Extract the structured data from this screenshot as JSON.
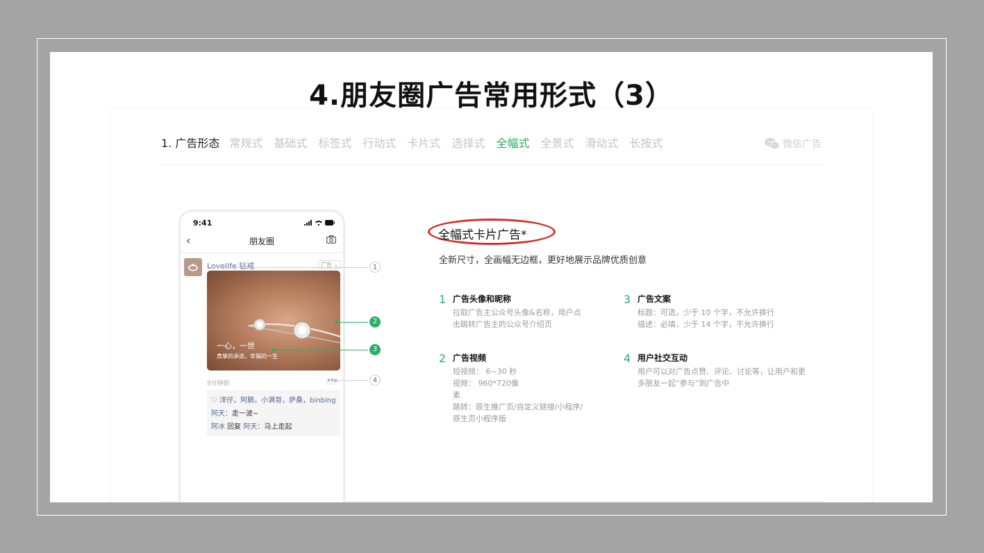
{
  "slide": {
    "title": "4.朋友圈广告常用形式（3）"
  },
  "nav": {
    "lead": "1. 广告形态",
    "tabs": [
      "常规式",
      "基础式",
      "标签式",
      "行动式",
      "卡片式",
      "选择式",
      "全幅式",
      "全景式",
      "滑动式",
      "长按式"
    ],
    "active_index": 6,
    "brand": "微信广告"
  },
  "phone": {
    "time": "9:41",
    "header_title": "朋友圈",
    "account": "Lovelife 钻戒",
    "ad_tag": "广告",
    "media_copy_1": "一心，一世",
    "media_copy_2": "真挚的承诺，幸福的一生",
    "post_time": "9分钟前",
    "likes": "洋仔，阿鹏，小满哥，萨桑，binbing",
    "comment1_user": "阿天：",
    "comment1_text": "走一波~",
    "comment2_user": "阿冰",
    "comment2_mid": " 回复 ",
    "comment2_target": "阿天：",
    "comment2_text": "马上走起"
  },
  "callouts": [
    "1",
    "2",
    "3",
    "4"
  ],
  "content": {
    "heading": "全幅式卡片广告*",
    "subheading": "全新尺寸，全画幅无边框，更好地展示品牌优质创意",
    "features": [
      {
        "num": "1",
        "title": "广告头像和昵称",
        "lines": [
          "拉取广告主公众号头像&名称，用户点",
          "击跳转广告主的公众号介绍页"
        ]
      },
      {
        "num": "2",
        "title": "广告视频",
        "lines": [
          "短视频：  6~30 秒",
          "视频：  960*720像",
          "素",
          "跳转：原生推广页/自定义链接/小程序/",
          "原生页小程序版"
        ]
      },
      {
        "num": "3",
        "title": "广告文案",
        "lines": [
          "标题：可选，少于 10 个字，不允许换行",
          "描述：必填，少于 14 个字，不允许换行"
        ]
      },
      {
        "num": "4",
        "title": "用户社交互动",
        "lines": [
          "用户可以对广告点赞、评论、讨论等，让用户和更",
          "多朋友一起“参与”到广告中"
        ]
      }
    ]
  },
  "colors": {
    "accent_green": "#2aae67",
    "highlight_red": "#d92a2a",
    "link_blue": "#576b95"
  }
}
